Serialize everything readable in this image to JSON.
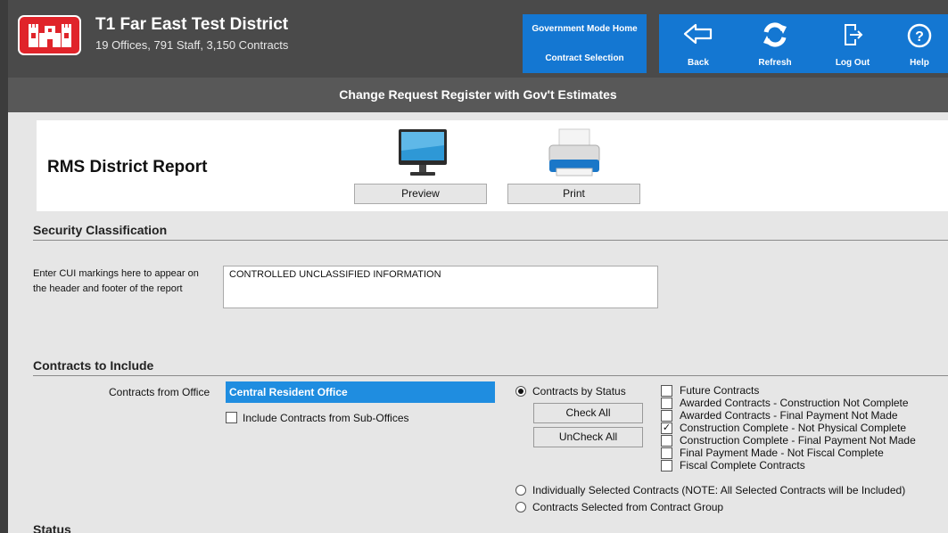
{
  "header": {
    "org_title": "T1 Far East Test District",
    "org_subtitle": "19 Offices, 791 Staff, 3,150 Contracts",
    "gov_home": "Government Mode Home",
    "contract_selection": "Contract Selection",
    "back": "Back",
    "refresh": "Refresh",
    "logout": "Log Out",
    "help": "Help"
  },
  "page_title": "Change Request Register with Gov't Estimates",
  "report": {
    "title": "RMS District Report",
    "preview": "Preview",
    "print": "Print"
  },
  "security": {
    "heading": "Security Classification",
    "label": "Enter CUI markings here to appear on the header and footer of the report",
    "value": "CONTROLLED UNCLASSIFIED INFORMATION"
  },
  "contracts": {
    "heading": "Contracts to Include",
    "office_label": "Contracts from Office",
    "office_value": "Central Resident Office",
    "include_sub": "Include Contracts from Sub-Offices",
    "by_status": "Contracts by Status",
    "check_all": "Check All",
    "uncheck_all": "UnCheck All",
    "statuses": [
      {
        "label": "Future Contracts",
        "checked": false
      },
      {
        "label": "Awarded Contracts - Construction Not Complete",
        "checked": false
      },
      {
        "label": "Awarded Contracts - Final Payment Not Made",
        "checked": false
      },
      {
        "label": "Construction Complete - Not Physical Complete",
        "checked": true
      },
      {
        "label": "Construction Complete - Final Payment Not Made",
        "checked": false
      },
      {
        "label": "Final Payment Made - Not Fiscal Complete",
        "checked": false
      },
      {
        "label": "Fiscal Complete Contracts",
        "checked": false
      }
    ],
    "individual": "Individually Selected Contracts (NOTE: All Selected Contracts will be Included)",
    "from_group": "Contracts Selected from Contract Group"
  },
  "status_section": {
    "heading": "Status"
  },
  "colors": {
    "header_bg": "#4a4a4a",
    "nav_blue": "#1477d2",
    "logo_red": "#e0242a",
    "select_blue": "#1f8de0"
  }
}
